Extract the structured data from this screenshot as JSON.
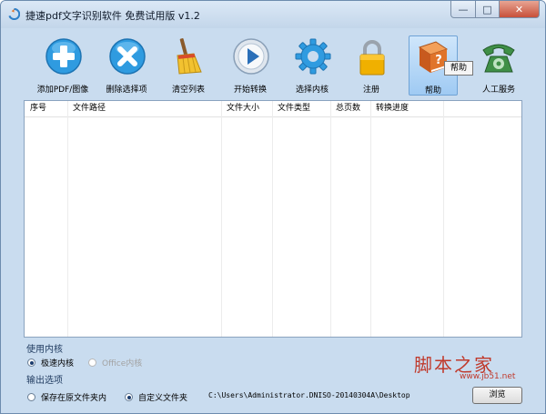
{
  "window": {
    "title": "捷速pdf文字识别软件 免费试用版 v1.2",
    "min_glyph": "—",
    "max_glyph": "□",
    "close_glyph": "✕"
  },
  "toolbar": {
    "buttons": [
      {
        "label": "添加PDF/图像",
        "icon": "plus-circle-icon"
      },
      {
        "label": "删除选择项",
        "icon": "x-circle-icon"
      },
      {
        "label": "清空列表",
        "icon": "broom-icon"
      },
      {
        "label": "开始转换",
        "icon": "play-icon"
      },
      {
        "label": "选择内核",
        "icon": "gear-icon"
      },
      {
        "label": "注册",
        "icon": "lock-icon"
      },
      {
        "label": "帮助",
        "icon": "help-book-icon"
      },
      {
        "label": "人工服务",
        "icon": "phone-icon"
      }
    ],
    "tooltip": "帮助"
  },
  "table": {
    "columns": [
      "序号",
      "文件路径",
      "文件大小",
      "文件类型",
      "总页数",
      "转换进度"
    ]
  },
  "engine": {
    "section_label": "使用内核",
    "options": [
      "极速内核",
      "Office内核"
    ],
    "selected": "极速内核"
  },
  "output": {
    "section_label": "输出选项",
    "options": [
      "保存在原文件夹内",
      "自定义文件夹"
    ],
    "selected": "自定义文件夹",
    "path": "C:\\Users\\Administrator.DNISO-20140304A\\Desktop",
    "browse_label": "浏览"
  },
  "watermark": {
    "main": "脚本之家",
    "sub": "www.jb51.net"
  },
  "colors": {
    "accent_blue": "#2f9be0",
    "help_orange": "#e0742a",
    "phone_green": "#3f8f47",
    "lock_gold": "#f0b000",
    "watermark_red": "#c0392b"
  }
}
